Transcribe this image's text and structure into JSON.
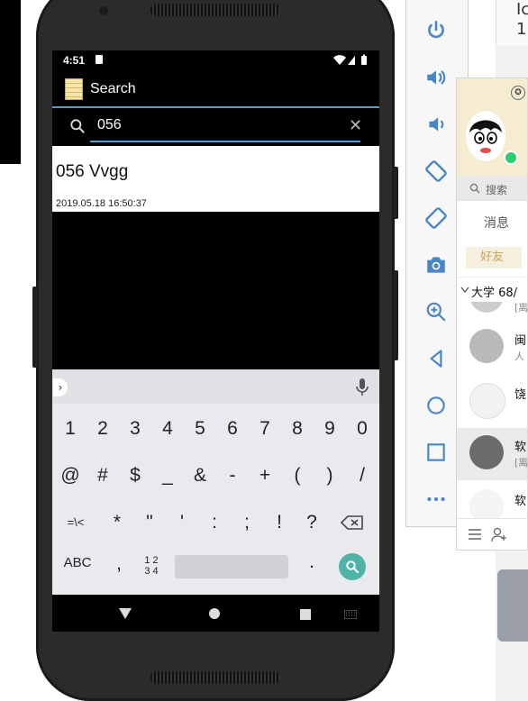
{
  "background": {
    "fragment_top": "Ic",
    "fragment_second": "1"
  },
  "phone": {
    "status": {
      "time": "4:51"
    },
    "app": {
      "title": "Search"
    },
    "search": {
      "value": "056",
      "placeholder": ""
    },
    "result": {
      "title": "056 Vvgg",
      "date": "2019.05.18 16:50:37"
    },
    "keyboard": {
      "row1": [
        "1",
        "2",
        "3",
        "4",
        "5",
        "6",
        "7",
        "8",
        "9",
        "0"
      ],
      "row2": [
        "@",
        "#",
        "$",
        "_",
        "&",
        "-",
        "+",
        "(",
        ")",
        "/"
      ],
      "row3": [
        "=\\<",
        "*",
        "\"",
        "'",
        ":",
        ";",
        "!",
        "?"
      ],
      "row4": {
        "abc": "ABC",
        "comma": ",",
        "num_top": "1 2",
        "num_bottom": "3 4",
        "period": "."
      }
    }
  },
  "emulator_toolbar": [
    "power-icon",
    "volume-up-icon",
    "volume-down-icon",
    "rotate-left-icon",
    "rotate-right-icon",
    "camera-icon",
    "zoom-in-icon",
    "back-icon",
    "home-icon",
    "overview-icon",
    "more-icon"
  ],
  "qq": {
    "search_label": "搜索",
    "tab_messages": "消息",
    "tab_friends": "好友",
    "group_label": "大学 68/",
    "items": [
      {
        "name": "闽",
        "sub": "人"
      },
      {
        "name": "饶",
        "sub": ""
      },
      {
        "name": "软",
        "sub": "[离"
      },
      {
        "name": "软",
        "sub": ""
      }
    ],
    "partial_top_sub": "[离"
  },
  "colors": {
    "accent": "#4a9fd6",
    "key_go": "#4fb3a8",
    "qq_online": "#2ecc71",
    "qq_friend": "#c9a45a"
  }
}
